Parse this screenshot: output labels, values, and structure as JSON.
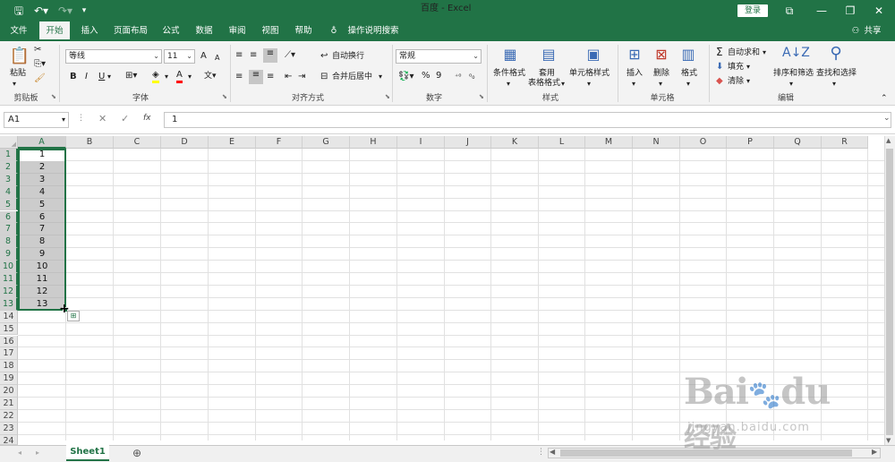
{
  "window": {
    "title": "百度 - Excel",
    "login": "登录"
  },
  "quick_access": {
    "save_icon": "save-icon",
    "undo_icon": "undo-icon",
    "redo_icon": "redo-icon",
    "customize_icon": "customize-icon"
  },
  "tabs": [
    "文件",
    "开始",
    "插入",
    "页面布局",
    "公式",
    "数据",
    "审阅",
    "视图",
    "帮助"
  ],
  "tell_me": "操作说明搜索",
  "share": "共享",
  "ribbon": {
    "clipboard": {
      "paste": "粘贴",
      "label": "剪贴板"
    },
    "font": {
      "name": "等线",
      "size": "11",
      "label": "字体",
      "bold": "B",
      "italic": "I",
      "underline": "U",
      "grow": "A",
      "shrink": "A",
      "font_color": "A"
    },
    "alignment": {
      "wrap": "自动换行",
      "merge": "合并后居中",
      "label": "对齐方式"
    },
    "number": {
      "format": "常规",
      "percent": "%",
      "comma": "9",
      "label": "数字"
    },
    "styles": {
      "conditional": "条件格式",
      "table_line1": "套用",
      "table_line2": "表格格式",
      "cell_styles": "单元格样式",
      "label": "样式"
    },
    "cells": {
      "insert": "插入",
      "delete": "删除",
      "format": "格式",
      "label": "单元格"
    },
    "editing": {
      "autosum": "自动求和",
      "fill": "填充",
      "clear": "清除",
      "sort": "排序和筛选",
      "find": "查找和选择",
      "label": "编辑"
    }
  },
  "formula_bar": {
    "name_box": "A1",
    "fx": "fx",
    "content": "1"
  },
  "columns": [
    "A",
    "B",
    "C",
    "D",
    "E",
    "F",
    "G",
    "H",
    "I",
    "J",
    "K",
    "L",
    "M",
    "N",
    "O",
    "P",
    "Q",
    "R"
  ],
  "rows": [
    "1",
    "2",
    "3",
    "4",
    "5",
    "6",
    "7",
    "8",
    "9",
    "10",
    "11",
    "12",
    "13",
    "14",
    "15",
    "16",
    "17",
    "18",
    "19",
    "20",
    "21",
    "22",
    "23",
    "24"
  ],
  "column_a_values": [
    "1",
    "2",
    "3",
    "4",
    "5",
    "6",
    "7",
    "8",
    "9",
    "10",
    "11",
    "12",
    "13"
  ],
  "sheet": {
    "name": "Sheet1",
    "add": "⊕"
  },
  "watermark": {
    "brand": "Bai",
    "brand2": "du",
    "brand_cn": "经验",
    "url": "jingyan.baidu.com"
  },
  "colors": {
    "accent": "#217346",
    "selection": "#aaaaaa"
  }
}
